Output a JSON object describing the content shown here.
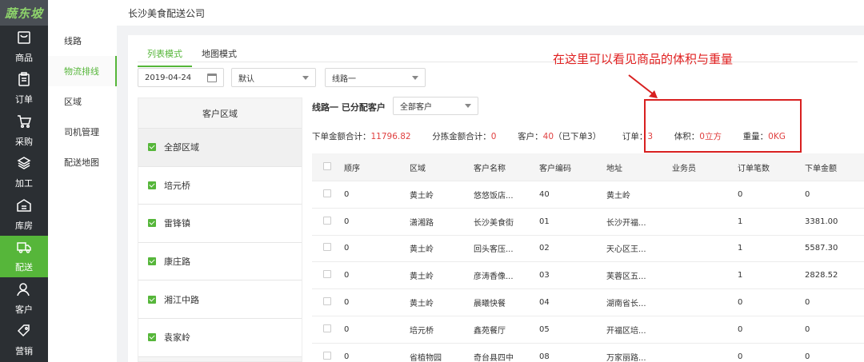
{
  "logo": "蔬东坡",
  "nav": [
    {
      "label": "商品",
      "icon": "tray-icon"
    },
    {
      "label": "订单",
      "icon": "clipboard-icon"
    },
    {
      "label": "采购",
      "icon": "cart-icon"
    },
    {
      "label": "加工",
      "icon": "layers-icon"
    },
    {
      "label": "库房",
      "icon": "warehouse-icon"
    },
    {
      "label": "配送",
      "icon": "truck-icon",
      "active": true
    },
    {
      "label": "客户",
      "icon": "user-icon"
    },
    {
      "label": "营销",
      "icon": "tag-icon"
    }
  ],
  "subnav": [
    {
      "label": "线路"
    },
    {
      "label": "物流排线",
      "active": true
    },
    {
      "label": "区域"
    },
    {
      "label": "司机管理"
    },
    {
      "label": "配送地图"
    }
  ],
  "header": {
    "title": "长沙美食配送公司"
  },
  "tabs": [
    {
      "label": "列表模式",
      "active": true
    },
    {
      "label": "地图模式"
    }
  ],
  "filters": {
    "date": "2019-04-24",
    "sort": "默认",
    "route": "线路一",
    "customer_filter": "全部客户"
  },
  "region_panel": {
    "header": "客户区域",
    "items": [
      "全部区域",
      "培元桥",
      "雷锋镇",
      "康庄路",
      "湘江中路",
      "袁家岭"
    ]
  },
  "route_title": "线路一 已分配客户",
  "stats": {
    "order_total_label": "下单金额合计：",
    "order_total": "11796.82",
    "sort_total_label": "分拣金额合计：",
    "sort_total": "0",
    "customers_label": "客户：",
    "customers_count": "40",
    "customers_ordered": "（已下单3）",
    "orders_label": "订单：",
    "orders_count": "3",
    "volume_label": "体积：",
    "volume": "0立方",
    "weight_label": "重量：",
    "weight": "0KG"
  },
  "annotation": "在这里可以看见商品的体积与重量",
  "table": {
    "columns": [
      "顺序",
      "区域",
      "客户名称",
      "客户编码",
      "地址",
      "业务员",
      "订单笔数",
      "下单金额"
    ],
    "rows": [
      [
        "0",
        "黄土岭",
        "悠悠饭店...",
        "40",
        "黄土岭",
        "",
        "0",
        "0"
      ],
      [
        "0",
        "潇湘路",
        "长沙美食街",
        "01",
        "长沙开福...",
        "",
        "1",
        "3381.00"
      ],
      [
        "0",
        "黄土岭",
        "回头客压...",
        "02",
        "天心区王...",
        "",
        "1",
        "5587.30"
      ],
      [
        "0",
        "黄土岭",
        "彦涛香像...",
        "03",
        "芙蓉区五...",
        "",
        "1",
        "2828.52"
      ],
      [
        "0",
        "黄土岭",
        "晨曦快餐",
        "04",
        "湖南省长...",
        "",
        "0",
        "0"
      ],
      [
        "0",
        "培元桥",
        "鑫苑餐厅",
        "05",
        "开福区培...",
        "",
        "0",
        "0"
      ],
      [
        "0",
        "省植物园",
        "奇台县四中",
        "08",
        "万家丽路...",
        "",
        "0",
        "0"
      ]
    ]
  },
  "colors": {
    "accent": "#56b63a",
    "nav_bg": "#2b2f33",
    "alert": "#e04040",
    "annotation": "#d82020"
  }
}
